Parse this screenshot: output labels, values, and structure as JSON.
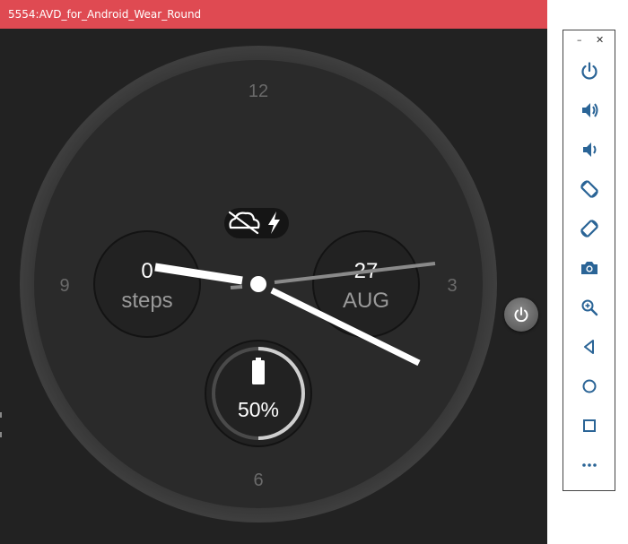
{
  "window": {
    "title": "5554:AVD_for_Android_Wear_Round"
  },
  "watch_face": {
    "hour_labels": {
      "twelve": "12",
      "three": "3",
      "six": "6",
      "nine": "9"
    },
    "steps_complication": {
      "value": "0",
      "label": "steps"
    },
    "date_complication": {
      "day": "27",
      "month": "AUG"
    },
    "battery_complication": {
      "text": "50%",
      "level": 0.5
    },
    "status_icons": [
      "cloud-off-icon",
      "charging-bolt-icon"
    ]
  },
  "toolbar": {
    "buttons": [
      "power-icon",
      "volume-up-icon",
      "volume-down-icon",
      "rotate-left-icon",
      "rotate-right-icon",
      "camera-icon",
      "zoom-icon",
      "back-icon",
      "home-icon",
      "overview-icon",
      "more-icon"
    ]
  },
  "colors": {
    "title_bar": "#df4a52",
    "face": "#2a2a2a",
    "hands": "#ffffff"
  }
}
